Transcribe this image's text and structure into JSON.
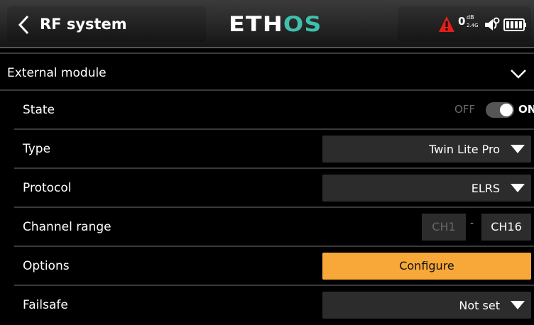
{
  "header": {
    "title": "RF system",
    "logo_main": "ETH",
    "logo_accent": "OS",
    "status": {
      "rssi_value": "0",
      "rssi_unit": "dB",
      "rssi_band": "2.4G",
      "alert_icon": "warning-triangle-icon",
      "speaker_icon": "speaker-icon",
      "battery_icon": "battery-icon"
    }
  },
  "colors": {
    "accent_teal": "#3fc0ad",
    "alert_red": "#e0201c",
    "button_orange": "#f7a838"
  },
  "section": {
    "title": "External module",
    "expanded": true
  },
  "rows": {
    "state": {
      "label": "State",
      "off_label": "OFF",
      "on_label": "ON",
      "value": true
    },
    "type": {
      "label": "Type",
      "value": "Twin Lite Pro"
    },
    "protocol": {
      "label": "Protocol",
      "value": "ELRS"
    },
    "channel_range": {
      "label": "Channel range",
      "from": "CH1",
      "separator": "-",
      "to": "CH16"
    },
    "options": {
      "label": "Options",
      "button": "Configure"
    },
    "failsafe": {
      "label": "Failsafe",
      "value": "Not set"
    }
  }
}
